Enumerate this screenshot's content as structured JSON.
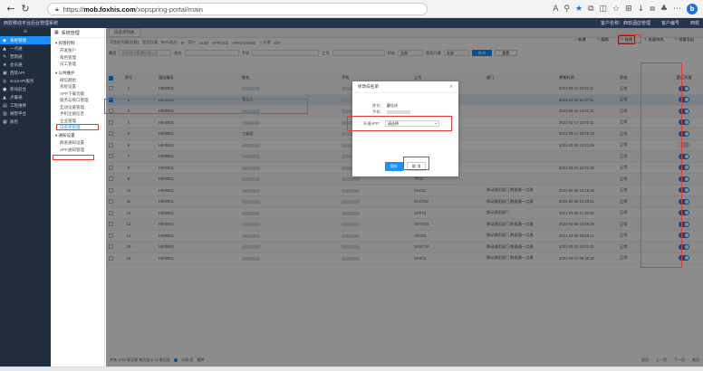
{
  "browser": {
    "url_host": "mob.foxhis.com",
    "url_prefix": "https://",
    "url_path": "/xopspring-portal/main",
    "profile_letter": "b"
  },
  "header": {
    "title": "西软移动平台后台管理系统",
    "right_1": "客户名称：西软酒店管理",
    "right_2": "客户编号",
    "right_3": "西软"
  },
  "sidebar": {
    "collapse_icon": "≡",
    "items": [
      {
        "icon": "◆",
        "label": "系统管理"
      },
      {
        "icon": "▲",
        "label": "一点通"
      },
      {
        "icon": "✎",
        "label": "营销通"
      },
      {
        "icon": "★",
        "label": "会员通"
      },
      {
        "icon": "▣",
        "label": "西软API"
      },
      {
        "icon": "◎",
        "label": "ecoXAPI服务"
      },
      {
        "icon": "●",
        "label": "移动前台"
      },
      {
        "icon": "▲",
        "label": "点餐通"
      },
      {
        "icon": "▤",
        "label": "工程维修"
      },
      {
        "icon": "▥",
        "label": "微赞平台"
      },
      {
        "icon": "▦",
        "label": "质检"
      }
    ]
  },
  "submenu": {
    "title": "系统管理",
    "groups": [
      {
        "label": "▾ 权限控制",
        "items": [
          "开发账户",
          "角色管理",
          "员工管理"
        ]
      },
      {
        "label": "▾ 公共维护",
        "items": [
          "微信群组",
          "系统设置",
          "APP下载功能",
          "服务与接口管理",
          "互动设备管理",
          "手机注册信息",
          "企业管理",
          "白名单管理"
        ]
      },
      {
        "label": "▾ 通知设置",
        "items": [
          "群发通知设置",
          "APP通知管理"
        ]
      }
    ],
    "active_item": "白名单管理"
  },
  "main": {
    "tab_label": "白名单列表",
    "crumbs": [
      "可信任列表(总数)",
      "是否开通",
      "MAC地址",
      "IP",
      "用户",
      "UUID",
      "APP(iOS)",
      "APP(Android)",
      "一点通",
      "iOS"
    ],
    "toolbar": [
      {
        "icon": "+",
        "label": "新增"
      },
      {
        "icon": "✎",
        "label": "编辑"
      },
      {
        "icon": "✎",
        "label": "修改"
      },
      {
        "icon": "✎",
        "label": "批量修改"
      },
      {
        "icon": "✎",
        "label": "批量导出"
      }
    ],
    "filters": {
      "tenant_label": "集团",
      "tenant_placeholder": "西软酒店管理有限公司",
      "name_label": "姓名",
      "phone_label": "手机",
      "id_label": "工号",
      "status_label": "状态",
      "status_value": "全部",
      "open_label": "是否开通",
      "open_value": "全部",
      "search": "查询",
      "reset": "重置"
    }
  },
  "table": {
    "headers": [
      "序号",
      "酒店编号",
      "姓名",
      "手机",
      "工号",
      "部门",
      "更新时间",
      "状态",
      "是否开通"
    ],
    "rows": [
      {
        "idx": "1",
        "tenant": "H000001",
        "name": "",
        "phone": "",
        "id": "",
        "dept": "",
        "time": "2021-03-11 20:22:11",
        "status": "正常",
        "on": true
      },
      {
        "idx": "2",
        "tenant": "H000001",
        "name": "曹佳庆",
        "phone": "",
        "id": "",
        "dept": "",
        "time": "2021-03-15 11:07:11",
        "status": "正常",
        "on": true
      },
      {
        "idx": "3",
        "tenant": "H000001",
        "name": "",
        "phone": "",
        "id": "",
        "dept": "",
        "time": "2021-03-16 14:01:11",
        "status": "正常",
        "on": true
      },
      {
        "idx": "4",
        "tenant": "H000001",
        "name": "",
        "phone": "",
        "id": "",
        "dept": "",
        "time": "2021-02-17 10:03:11",
        "status": "正常",
        "on": true
      },
      {
        "idx": "5",
        "tenant": "H000001",
        "name": "三级组",
        "phone": "",
        "id": "",
        "dept": "",
        "time": "2021-03-17 10:05:13",
        "status": "正常",
        "on": true
      },
      {
        "idx": "6",
        "tenant": "H000001",
        "name": "",
        "phone": "",
        "id": "",
        "dept": "",
        "time": "2021-03-20 13:41:49",
        "status": "正常",
        "on": false
      },
      {
        "idx": "7",
        "tenant": "H000001",
        "name": "",
        "phone": "",
        "id": "",
        "dept": "",
        "time": "",
        "status": "正常",
        "on": true
      },
      {
        "idx": "8",
        "tenant": "H000001",
        "name": "",
        "phone": "",
        "id": "",
        "dept": "",
        "time": "2021-03-21 12:01:19",
        "status": "正常",
        "on": true
      },
      {
        "idx": "9",
        "tenant": "H000001",
        "name": "",
        "phone": "",
        "id": "TP03",
        "dept": "",
        "time": "",
        "status": "正常",
        "on": true
      },
      {
        "idx": "10",
        "tenant": "H000001",
        "name": "",
        "phone": "",
        "id": "XXC01",
        "dept": "移动通用部门,数据通一点通",
        "time": "2021-02-26 13:16:18",
        "status": "正常",
        "on": true
      },
      {
        "idx": "11",
        "tenant": "H000001",
        "name": "",
        "phone": "",
        "id": "XXCY02",
        "dept": "移动通用部门,数据通一点通",
        "time": "2021-02-26 13:40:11",
        "status": "正常",
        "on": true
      },
      {
        "idx": "12",
        "tenant": "H000001",
        "name": "",
        "phone": "",
        "id": "XXFY3",
        "dept": "移动通用部门",
        "time": "2021-03-08 11:29:33",
        "status": "正常",
        "on": true
      },
      {
        "idx": "13",
        "tenant": "H000001",
        "name": "",
        "phone": "",
        "id": "XXYC03",
        "dept": "移动通用部门,数据通一点通",
        "time": "2021-03-05 10:58:29",
        "status": "正常",
        "on": true
      },
      {
        "idx": "14",
        "tenant": "H000001",
        "name": "",
        "phone": "",
        "id": "XXAD1",
        "dept": "移动通用部门,数据通一点通",
        "time": "2021-03-09 15:06:21",
        "status": "正常",
        "on": true
      },
      {
        "idx": "15",
        "tenant": "H000001",
        "name": "",
        "phone": "",
        "id": "XXSOYA",
        "dept": "移动通用部门,数据通一点通",
        "time": "2021-03-13 15:03:41",
        "status": "正常",
        "on": true
      },
      {
        "idx": "16",
        "tenant": "H000001",
        "name": "",
        "phone": "",
        "id": "XXSO1",
        "dept": "移动通用部门,数据通一点通",
        "time": "2021-03-17 09:40:16",
        "status": "正常",
        "on": true
      }
    ]
  },
  "modal": {
    "title": "修改白名单",
    "close_icon": "×",
    "name_label": "姓名：",
    "name_value": "曹佳庆",
    "phone_label": "手机：",
    "select_label": "开通APP：",
    "select_value": "请选择",
    "select_arrow": "▾",
    "ok": "保存",
    "cancel": "取 消"
  },
  "pager": {
    "summary": "共有 1292 条记录 每页显示 15 条记录",
    "page_size": "15条/页",
    "goto_label": "跳转",
    "prev": "上一页",
    "next": "下一页",
    "first": "首页",
    "last": "尾页"
  }
}
